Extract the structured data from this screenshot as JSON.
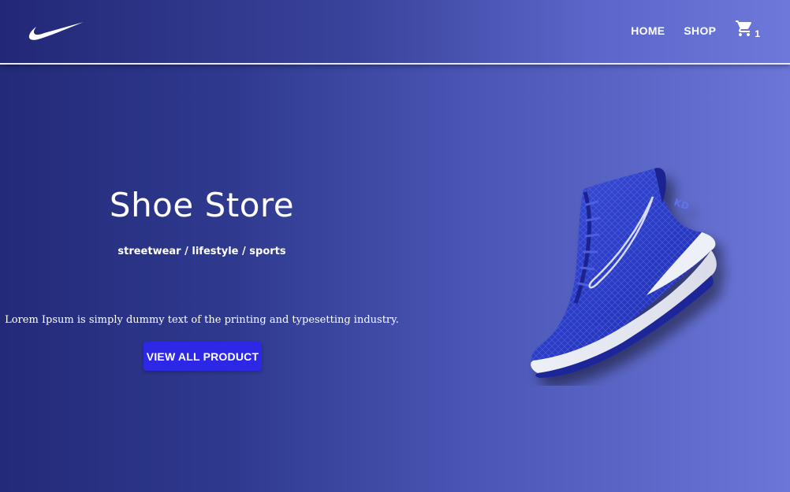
{
  "header": {
    "logo_icon": "swoosh-icon",
    "nav": [
      {
        "label": "HOME"
      },
      {
        "label": "SHOP"
      }
    ],
    "cart": {
      "icon": "cart-icon",
      "count": "1"
    }
  },
  "hero": {
    "title": "Shoe Store",
    "subtitle": "streetwear / lifestyle / sports",
    "body": "Lorem Ipsum is simply dummy text of the printing and typesetting industry.",
    "cta_label": "VIEW ALL PRODUCT",
    "image_icon": "sneaker-image"
  },
  "colors": {
    "accent": "#2d27e6",
    "background_start": "#232a78",
    "background_end": "#6b76d8"
  }
}
